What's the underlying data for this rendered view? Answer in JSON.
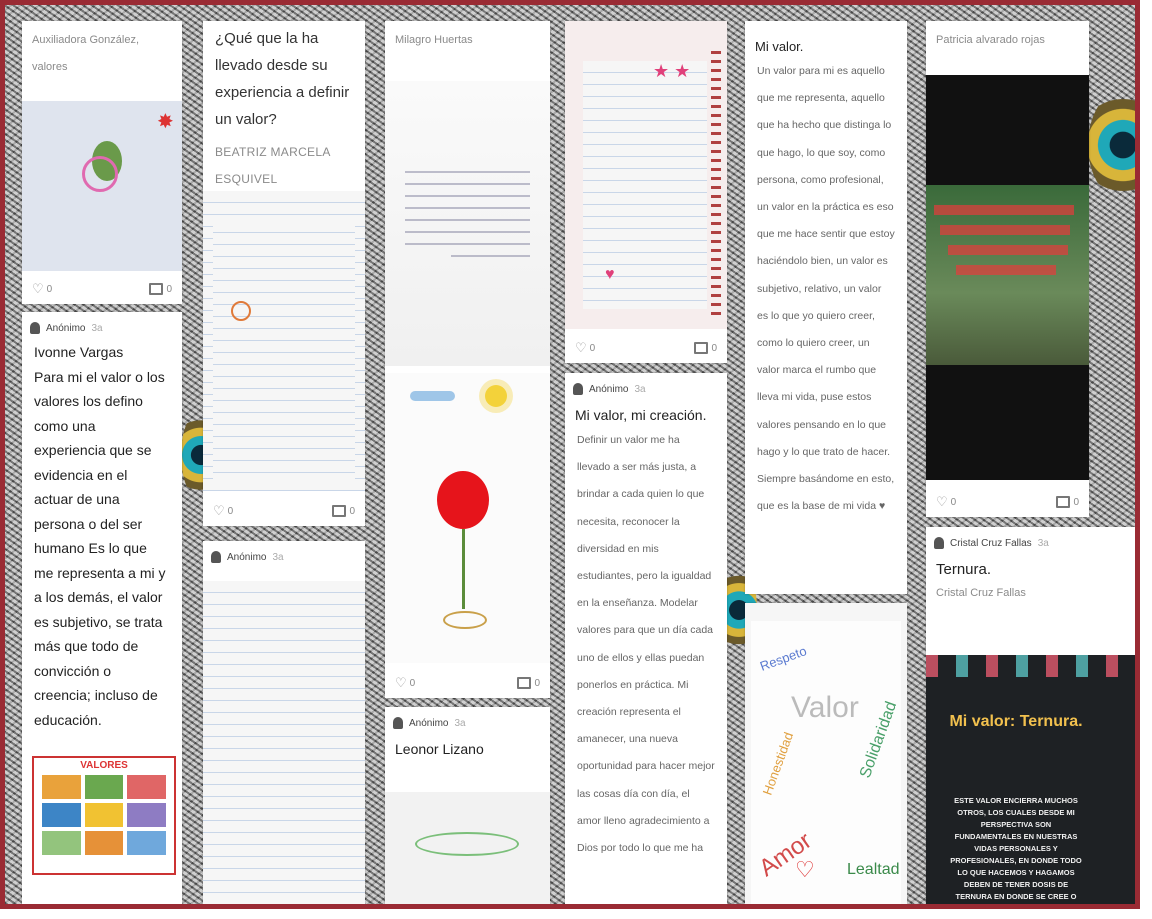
{
  "col1": {
    "card1_meta": "Auxiliadora González,",
    "card1_meta2": "valores",
    "card1_likes": "0",
    "card1_comments": "0",
    "card2_author": "Anónimo",
    "card2_ago": "3a",
    "card2_text": "Ivonne  Vargas\nPara mi el valor o los valores los defino como una experiencia que se evidencia en el actuar de una persona o del ser humano Es lo que me representa a mi y a los demás, el valor es subjetivo, se trata más que todo de convicción o creencia; incluso de educación.",
    "card2_img_label": "VALORES"
  },
  "col2": {
    "card1_question": "¿Qué que la ha llevado desde su experiencia a definir un valor?",
    "card1_author": "BEATRIZ MARCELA ESQUIVEL TRIGUEROS",
    "card1_likes": "0",
    "card1_comments": "0",
    "card2_author": "Anónimo",
    "card2_ago": "3a"
  },
  "col3": {
    "card1_meta": "Milagro Huertas",
    "card1_likes": "0",
    "card1_comments": "0",
    "card2_author": "Anónimo",
    "card2_ago": "3a",
    "card2_title": "Leonor Lizano"
  },
  "col4": {
    "card1_likes": "0",
    "card1_comments": "0",
    "card2_author": "Anónimo",
    "card2_ago": "3a",
    "card2_title": "Mi valor, mi creación.",
    "card2_text": "Definir un valor me ha llevado a ser más justa, a brindar a cada quien lo que necesita, reconocer la diversidad en mis estudiantes, pero la igualdad en la enseñanza. Modelar valores para que un día cada uno de ellos y ellas puedan ponerlos en práctica.  Mi creación representa el amanecer, una nueva oportunidad para hacer mejor las cosas día con día, el amor lleno agradecimiento a Dios por todo lo que me ha"
  },
  "col5": {
    "card1_title": "Mi valor.",
    "card1_text": "Un valor para mi es aquello que me representa, aquello que ha hecho que distinga lo que hago, lo que soy, como persona, como profesional, un valor en la práctica es eso que me hace sentir que estoy haciéndolo bien, un valor es subjetivo, relativo, un valor es lo que yo quiero creer, como lo quiero creer, un valor marca el rumbo que lleva mi vida, puse estos valores pensando en lo que hago y lo que trato de hacer. Siempre basándome en esto, que es la base de mi vida ♥",
    "img_words": [
      "Valor",
      "Amor",
      "Solidaridad",
      "Lealtad",
      "Respeto",
      "Honestidad"
    ]
  },
  "col6": {
    "card1_meta": "Patricia  alvarado rojas",
    "card1_likes": "0",
    "card1_comments": "0",
    "card2_author": "Cristal Cruz Fallas",
    "card2_ago": "3a",
    "card2_title": "Ternura.",
    "card2_sub": "Cristal Cruz Fallas",
    "poster_title": "Mi valor: Ternura.",
    "poster_text": "ESTE VALOR ENCIERRA MUCHOS OTROS, LOS CUALES DESDE MI PERSPECTIVA SON FUNDAMENTALES EN NUESTRAS VIDAS PERSONALES Y PROFESIONALES, EN DONDE TODO LO QUE HACEMOS Y HAGAMOS DEBEN DE TENER DOSIS DE TERNURA EN DONDE SE CREE O REFUERCE EL VÍNCULO CON EL OTRO."
  },
  "colors": {
    "frame": "#9a2b34",
    "poster_bg": "#1e2124",
    "poster_title": "#f2c14e"
  }
}
